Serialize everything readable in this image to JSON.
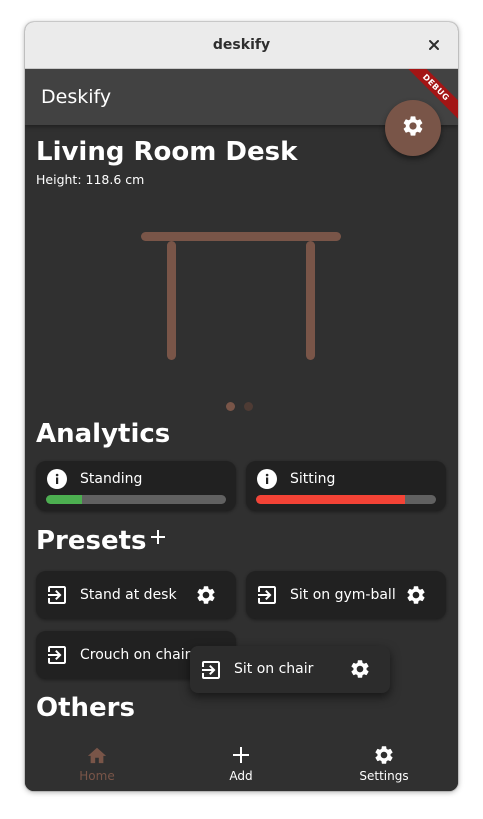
{
  "window": {
    "title": "deskify"
  },
  "appbar": {
    "title": "Deskify",
    "debug_banner": "DEBUG"
  },
  "desk": {
    "name": "Living Room Desk",
    "height_text": "Height: 118.6 cm",
    "color": "#795548",
    "pages": 2,
    "active_page": 1
  },
  "analytics": {
    "title": "Analytics",
    "items": [
      {
        "label": "Standing",
        "fraction": 0.2,
        "color": "#4caf50"
      },
      {
        "label": "Sitting",
        "fraction": 0.83,
        "color": "#f44336"
      }
    ]
  },
  "presets": {
    "title": "Presets",
    "items": [
      {
        "label": "Stand at desk"
      },
      {
        "label": "Sit on gym-ball"
      },
      {
        "label": "Crouch on chair"
      }
    ],
    "dragging": {
      "label": "Sit on chair"
    }
  },
  "others": {
    "title": "Others"
  },
  "bottom_nav": {
    "items": [
      {
        "label": "Home",
        "icon": "home-icon",
        "active": true
      },
      {
        "label": "Add",
        "icon": "add-icon",
        "active": false
      },
      {
        "label": "Settings",
        "icon": "settings-icon",
        "active": false
      }
    ]
  },
  "colors": {
    "accent": "#795548",
    "background": "#303030",
    "card": "#212121",
    "appbar": "#424242"
  }
}
